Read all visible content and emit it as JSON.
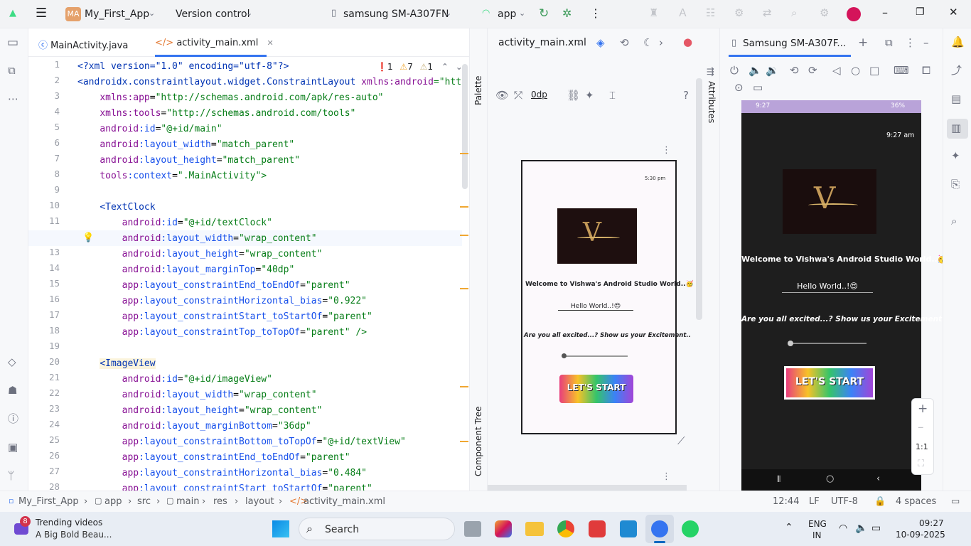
{
  "titlebar": {
    "project_badge": "MA",
    "project_name": "My_First_App",
    "vcs": "Version control",
    "device": "samsung SM-A307FN",
    "run_config": "app"
  },
  "editor": {
    "tabs": [
      {
        "label": "MainActivity.java"
      },
      {
        "label": "activity_main.xml"
      }
    ],
    "inspections": {
      "errors": "1",
      "warnings": "7",
      "weak": "1"
    },
    "line_numbers": [
      "1",
      "2",
      "3",
      "4",
      "5",
      "6",
      "7",
      "8",
      "9",
      "10",
      "11",
      "12",
      "13",
      "14",
      "15",
      "16",
      "17",
      "18",
      "19",
      "20",
      "21",
      "22",
      "23",
      "24",
      "25",
      "26",
      "27",
      "28"
    ],
    "current_line": 12,
    "code": {
      "l1_decl": "<?xml version=\"1.0\" encoding=\"utf-8\"?>",
      "l2_tag": "<androidx.constraintlayout.widget.ConstraintLayout ",
      "l2_attr": "xmlns:android",
      "l2_val": "=\"htt",
      "l3_attr": "xmlns:app",
      "l3_val": "\"http://schemas.android.com/apk/res-auto\"",
      "l4_attr": "xmlns:tools",
      "l4_val": "\"http://schemas.android.com/tools\"",
      "l5_ns": "android",
      "l5_attr": ":id",
      "l5_val": "\"@+id/main\"",
      "l6_ns": "android",
      "l6_attr": ":layout_width",
      "l6_val": "\"match_parent\"",
      "l7_ns": "android",
      "l7_attr": ":layout_height",
      "l7_val": "\"match_parent\"",
      "l8_ns": "tools",
      "l8_attr": ":context",
      "l8_val": "\".MainActivity\">",
      "l10_tag": "<TextClock",
      "l11_ns": "android",
      "l11_attr": ":id",
      "l11_val": "\"@+id/textClock\"",
      "l12_ns": "android",
      "l12_attr": ":layout_width",
      "l12_val": "\"wrap_content\"",
      "l13_ns": "android",
      "l13_attr": ":layout_height",
      "l13_val": "\"wrap_content\"",
      "l14_ns": "android",
      "l14_attr": ":layout_marginTop",
      "l14_val": "\"40dp\"",
      "l15_ns": "app",
      "l15_attr": ":layout_constraintEnd_toEndOf",
      "l15_val": "\"parent\"",
      "l16_ns": "app",
      "l16_attr": ":layout_constraintHorizontal_bias",
      "l16_val": "\"0.922\"",
      "l17_ns": "app",
      "l17_attr": ":layout_constraintStart_toStartOf",
      "l17_val": "\"parent\"",
      "l18_ns": "app",
      "l18_attr": ":layout_constraintTop_toTopOf",
      "l18_val": "\"parent\" />",
      "l20_tag": "<ImageView",
      "l21_ns": "android",
      "l21_attr": ":id",
      "l21_val": "\"@+id/imageView\"",
      "l22_ns": "android",
      "l22_attr": ":layout_width",
      "l22_val": "\"wrap_content\"",
      "l23_ns": "android",
      "l23_attr": ":layout_height",
      "l23_val": "\"wrap_content\"",
      "l24_ns": "android",
      "l24_attr": ":layout_marginBottom",
      "l24_val": "\"36dp\"",
      "l25_ns": "app",
      "l25_attr": ":layout_constraintBottom_toTopOf",
      "l25_val": "\"@+id/textView\"",
      "l26_ns": "app",
      "l26_attr": ":layout_constraintEnd_toEndOf",
      "l26_val": "\"parent\"",
      "l27_ns": "app",
      "l27_attr": ":layout_constraintHorizontal_bias",
      "l27_val": "\"0.484\"",
      "l28_ns": "app",
      "l28_attr": ":layout_constraintStart_toStartOf",
      "l28_val": "\"parent\""
    }
  },
  "design": {
    "file": "activity_main.xml",
    "margin": "0dp",
    "side_palette": "Palette",
    "side_component_tree": "Component Tree",
    "side_attributes": "Attributes",
    "preview": {
      "clock": "5:30 pm",
      "logo_letter": "V",
      "welcome": "Welcome to Vishwa's Android Studio World..🥳",
      "hello": "Hello World..!😍",
      "excited": "Are you all excited...? Show us your Excitement..",
      "start": "LET'S START"
    }
  },
  "mirror": {
    "tab_title": "Samsung SM-A307F...",
    "status_time": "9:27",
    "status_right": "36%",
    "clock": "9:27 am",
    "logo_letter": "V",
    "welcome": "Welcome to Vishwa's Android Studio World..🥳",
    "hello": "Hello World..!😍",
    "excited": "Are you all excited...? Show us your Excitement..",
    "start": "LET'S START",
    "zoom_ratio": "1:1"
  },
  "breadcrumb": [
    "My_First_App",
    "app",
    "src",
    "main",
    "res",
    "layout",
    "activity_main.xml"
  ],
  "status": {
    "position": "12:44",
    "line_sep": "LF",
    "encoding": "UTF-8",
    "indent": "4 spaces"
  },
  "taskbar": {
    "widget_badge": "8",
    "widget_title": "Trending videos",
    "widget_sub": "A Big Bold Beau...",
    "search": "Search",
    "lang1": "ENG",
    "lang2": "IN",
    "time": "09:27",
    "date": "10-09-2025"
  },
  "colors": {
    "accent": "#3574f0",
    "error": "#e55765",
    "warning": "#f0a732",
    "phone_bg": "#1e1e1e"
  }
}
